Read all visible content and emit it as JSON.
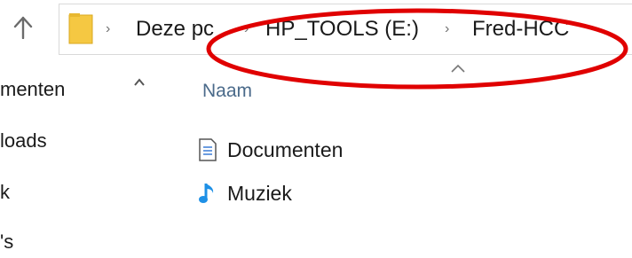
{
  "breadcrumb": {
    "items": [
      "Deze pc",
      "HP_TOOLS (E:)",
      "Fred-HCC"
    ]
  },
  "nav": {
    "items": [
      "menten",
      "loads",
      "k",
      "'s"
    ]
  },
  "content": {
    "column_header": "Naam",
    "files": [
      {
        "name": "Documenten",
        "icon": "document-icon"
      },
      {
        "name": "Muziek",
        "icon": "music-note-icon"
      }
    ]
  },
  "colors": {
    "annotation": "#e00000",
    "folder": "#f5c842",
    "music": "#1e90e6"
  }
}
